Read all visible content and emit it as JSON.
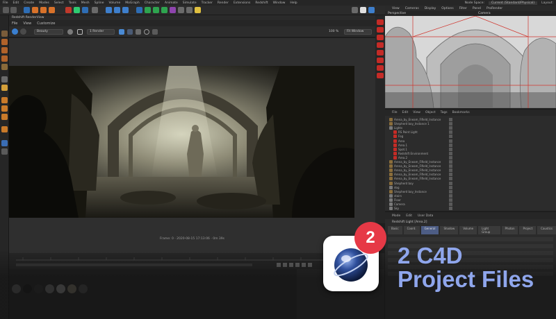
{
  "app": {
    "menus": [
      "File",
      "Edit",
      "Create",
      "Modes",
      "Select",
      "Tools",
      "Mesh",
      "Spline",
      "Volume",
      "MoGraph",
      "Character",
      "Animate",
      "Simulate",
      "Tracker",
      "Render",
      "Extensions",
      "Redshift",
      "Window",
      "Help"
    ],
    "node_space_label": "Node Space:",
    "node_space_value": "Current (Standard/Physical)",
    "layout_label": "Layout:"
  },
  "render_view": {
    "title": "Redshift RenderView",
    "menus": [
      "File",
      "View",
      "Customize"
    ],
    "beauty_select": "Beauty",
    "renderer_select": "1 Render",
    "zoom": "100 %",
    "fit_select": "Fit Window",
    "status": "Frame: 0 · 2020-08-15 17:13:06 · 0m 39s",
    "colors": {
      "accent_red": "#c42b26"
    }
  },
  "viewport": {
    "menus": [
      "View",
      "Cameras",
      "Display",
      "Options",
      "Filter",
      "Panel",
      "ProRender"
    ],
    "name": "Perspective",
    "camera": "Camera"
  },
  "object_manager": {
    "menus": [
      "File",
      "Edit",
      "View",
      "Object",
      "Tags",
      "Bookmarks"
    ],
    "rows": [
      "Arena_by_Eneam_Fifield_Instance",
      "Shepherd boy_Instance 1",
      "Lights",
      "RS Point Light",
      "Fog",
      "Area",
      "Area.1",
      "Spot.1",
      "Redshift Environment",
      "Area.2",
      "Arena_by_Eneam_Fifield_Instance",
      "Arena_by_Eneam_Fifield_Instance",
      "Arena_by_Eneam_Fifield_Instance",
      "Arena_by_Eneam_Fifield_Instance",
      "Arena_by_Eneam_Fifield_Instance",
      "Shepherd boy",
      "dog",
      "Shepherd boy_Instance",
      "stairs",
      "Floor",
      "Camera",
      "Sky"
    ]
  },
  "attribute_manager": {
    "menus": [
      "Mode",
      "Edit",
      "User Data"
    ],
    "object_name": "Redshift Light [Area.2]",
    "tabs": [
      "Basic",
      "Coord.",
      "General",
      "Shadow",
      "Volume",
      "Light Group",
      "Photon",
      "Project",
      "Caustics"
    ]
  },
  "promo": {
    "badge_number": "2",
    "line1": "2 C4D",
    "line2": "Project Files"
  }
}
